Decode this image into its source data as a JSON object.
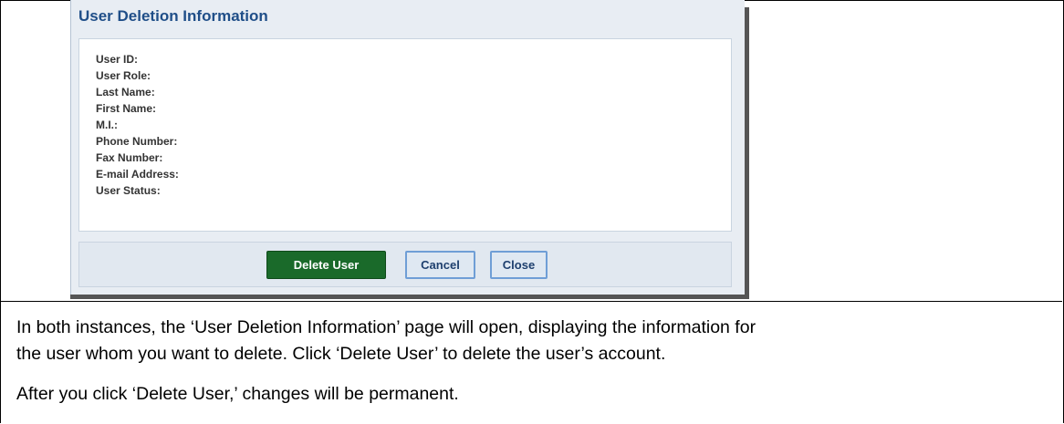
{
  "dialog": {
    "title": "User Deletion Information",
    "fields": [
      "User ID:",
      "User Role:",
      "Last Name:",
      "First Name:",
      "M.I.:",
      "Phone Number:",
      "Fax Number:",
      "E-mail Address:",
      "User Status:"
    ],
    "buttons": {
      "delete": "Delete User",
      "cancel": "Cancel",
      "close": "Close"
    }
  },
  "doc": {
    "line1": "In both instances, the ‘User Deletion Information’ page will open, displaying the information for",
    "line2": "the user whom you want to delete. Click ‘Delete User’ to delete the user’s account.",
    "line3": "After you click ‘Delete User,’ changes will be permanent."
  }
}
